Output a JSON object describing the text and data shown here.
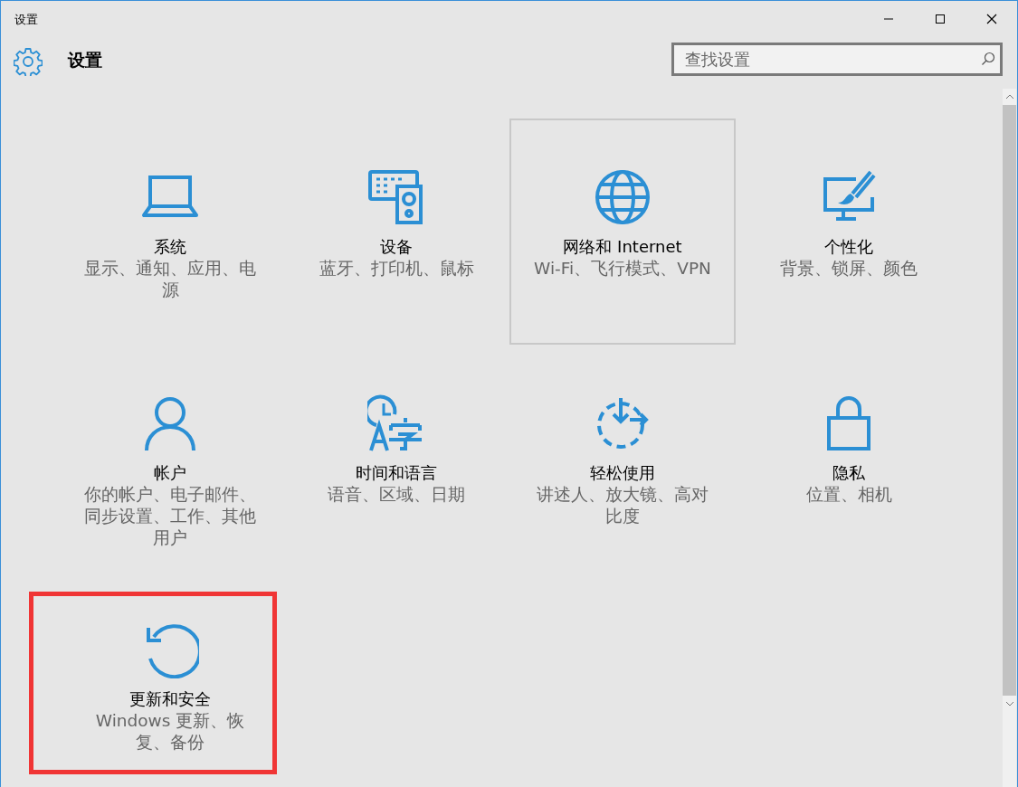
{
  "window": {
    "title": "设置"
  },
  "header": {
    "title": "设置",
    "search": {
      "placeholder": "查找设置"
    }
  },
  "tiles": [
    {
      "kind": "laptop",
      "title": "系统",
      "description": "显示、通知、应用、电源",
      "outlined": false,
      "annotated": false
    },
    {
      "kind": "devices",
      "title": "设备",
      "description": "蓝牙、打印机、鼠标",
      "outlined": false,
      "annotated": false
    },
    {
      "kind": "globe",
      "title": "网络和 Internet",
      "description": "Wi-Fi、飞行模式、VPN",
      "outlined": true,
      "annotated": false
    },
    {
      "kind": "paint",
      "title": "个性化",
      "description": "背景、锁屏、颜色",
      "outlined": false,
      "annotated": false
    },
    {
      "kind": "person",
      "title": "帐户",
      "description": "你的帐户、电子邮件、同步设置、工作、其他用户",
      "outlined": false,
      "annotated": false
    },
    {
      "kind": "timelang",
      "title": "时间和语言",
      "description": "语音、区域、日期",
      "outlined": false,
      "annotated": false
    },
    {
      "kind": "ease",
      "title": "轻松使用",
      "description": "讲述人、放大镜、高对比度",
      "outlined": false,
      "annotated": false
    },
    {
      "kind": "lock",
      "title": "隐私",
      "description": "位置、相机",
      "outlined": false,
      "annotated": false
    },
    {
      "kind": "update",
      "title": "更新和安全",
      "description": "Windows 更新、恢复、备份",
      "outlined": false,
      "annotated": true
    }
  ]
}
